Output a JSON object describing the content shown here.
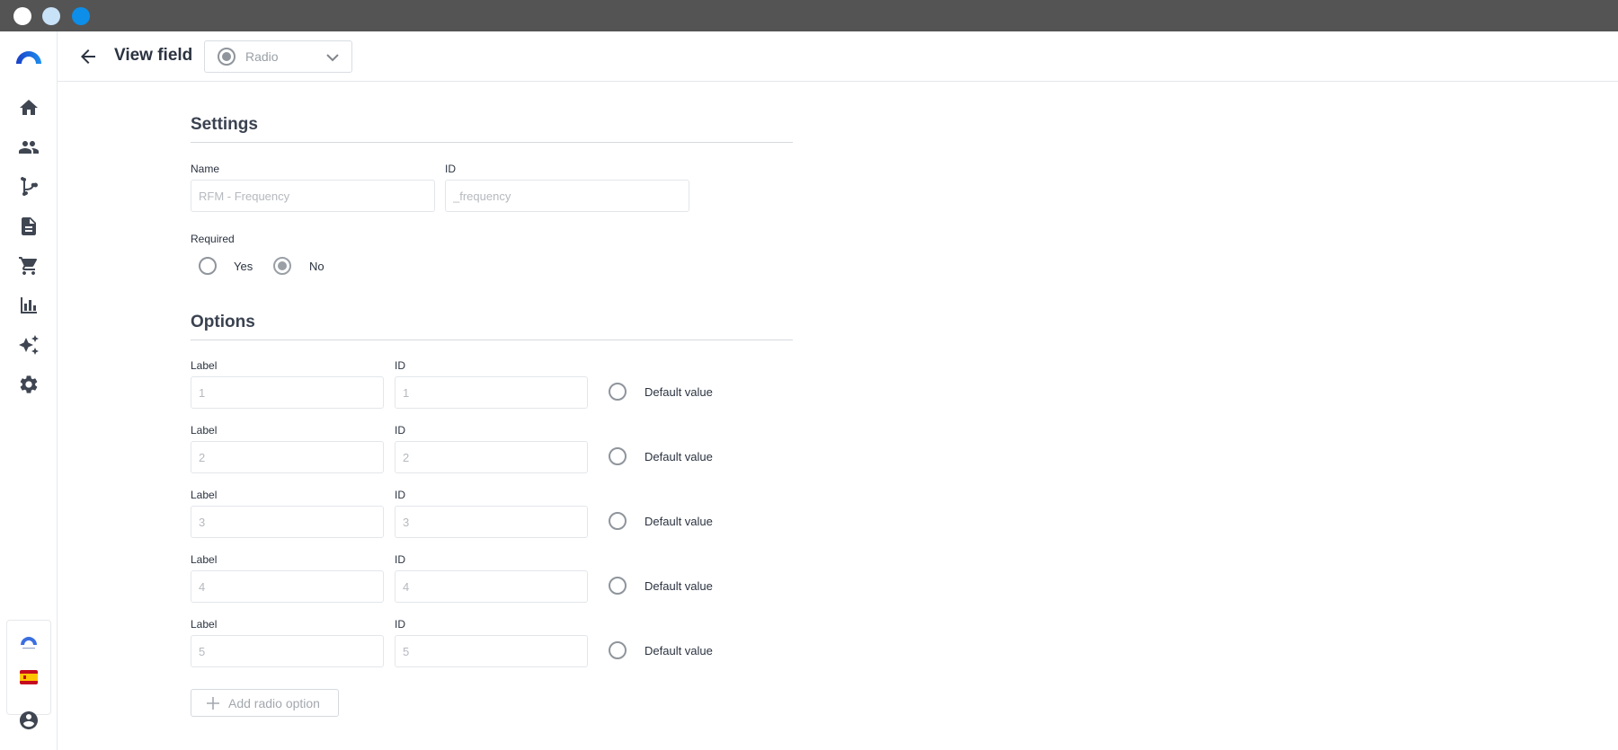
{
  "window": {
    "controls": [
      "close",
      "minimize",
      "zoom"
    ]
  },
  "sidebar": {
    "logo_icon": "brand-arc-icon",
    "items": [
      {
        "name": "home",
        "icon": "home-icon"
      },
      {
        "name": "contacts",
        "icon": "people-icon"
      },
      {
        "name": "flows",
        "icon": "branch-icon"
      },
      {
        "name": "content",
        "icon": "document-icon"
      },
      {
        "name": "commerce",
        "icon": "cart-icon"
      },
      {
        "name": "analytics",
        "icon": "bar-chart-icon"
      },
      {
        "name": "ai",
        "icon": "sparkles-icon"
      },
      {
        "name": "settings",
        "icon": "gear-icon"
      }
    ],
    "footer": [
      {
        "name": "workspace",
        "icon": "brand-arc-small-icon"
      },
      {
        "name": "language",
        "icon": "spain-flag-icon"
      },
      {
        "name": "account",
        "icon": "account-circle-icon"
      }
    ]
  },
  "header": {
    "title": "View field",
    "field_type": "Radio"
  },
  "settings": {
    "heading": "Settings",
    "name_label": "Name",
    "name_placeholder": "RFM - Frequency",
    "id_label": "ID",
    "id_placeholder": "_frequency",
    "required_label": "Required",
    "required_yes": "Yes",
    "required_no": "No",
    "required_value": "No"
  },
  "options": {
    "heading": "Options",
    "label_caption": "Label",
    "id_caption": "ID",
    "default_caption": "Default value",
    "rows": [
      {
        "label": "1",
        "id": "1"
      },
      {
        "label": "2",
        "id": "2"
      },
      {
        "label": "3",
        "id": "3"
      },
      {
        "label": "4",
        "id": "4"
      },
      {
        "label": "5",
        "id": "5"
      }
    ],
    "add_label": "Add radio option"
  }
}
